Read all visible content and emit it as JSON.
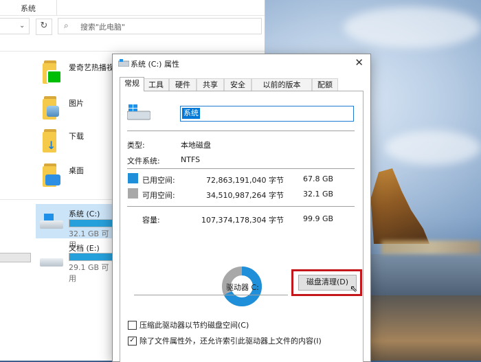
{
  "explorer": {
    "ribbon_tab": "系统",
    "search_placeholder": "搜索\"此电脑\"",
    "items": [
      {
        "label": "爱奇艺热播视频",
        "badge_color": "#00be06"
      },
      {
        "label": "图片",
        "badge_color": "#6aa7d8"
      },
      {
        "label": "下载",
        "badge_color": "#1f7fd6"
      },
      {
        "label": "桌面",
        "badge_color": "#2d8fe3"
      }
    ],
    "drives": [
      {
        "label": "系统 (C:)",
        "free_text": "32.1 GB 可用",
        "used_fraction": 0.68
      },
      {
        "label": "文档 (E:)",
        "free_text": "29.1 GB 可用",
        "used_fraction": 0.8
      }
    ]
  },
  "dialog": {
    "title": "系统 (C:) 属性",
    "close_glyph": "✕",
    "tabs": [
      "常规",
      "工具",
      "硬件",
      "共享",
      "安全",
      "以前的版本",
      "配额"
    ],
    "active_tab": "常规",
    "name_value": "系统",
    "type_label": "类型:",
    "type_value": "本地磁盘",
    "fs_label": "文件系统:",
    "fs_value": "NTFS",
    "used_label": "已用空间:",
    "used_bytes": "72,863,191,040 字节",
    "used_gb": "67.8 GB",
    "free_label": "可用空间:",
    "free_bytes": "34,510,987,264 字节",
    "free_gb": "32.1 GB",
    "capacity_label": "容量:",
    "capacity_bytes": "107,374,178,304 字节",
    "capacity_gb": "99.9 GB",
    "drive_label": "驱动器 C:",
    "cleanup_button": "磁盘清理(D)",
    "compress_label": "压缩此驱动器以节约磁盘空间(C)",
    "compress_checked": false,
    "index_label": "除了文件属性外，还允许索引此驱动器上文件的内容(I)",
    "index_checked": true,
    "check_glyph": "✓",
    "colors": {
      "used": "#1e8fd8",
      "free": "#a8a8a8",
      "highlight": "#c4171c"
    }
  }
}
